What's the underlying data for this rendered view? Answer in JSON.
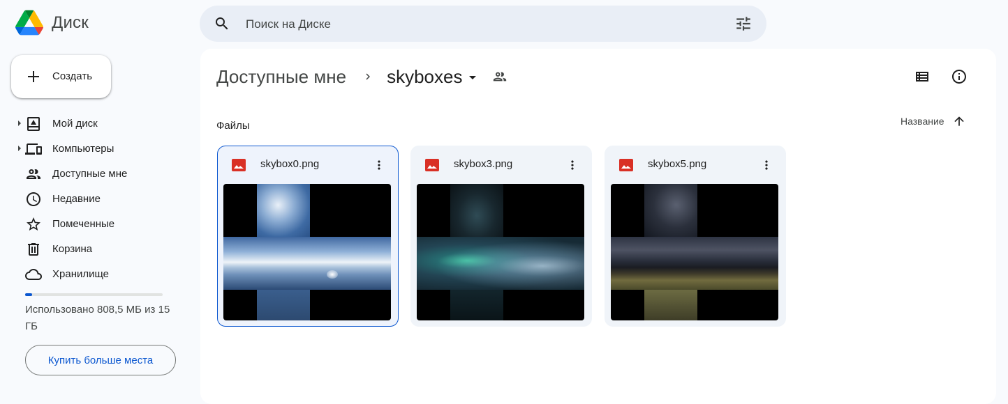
{
  "app": {
    "name": "Диск"
  },
  "search": {
    "placeholder": "Поиск на Диске"
  },
  "sidebar": {
    "new_label": "Создать",
    "items": [
      {
        "label": "Мой диск",
        "icon": "my-drive-icon",
        "expandable": true
      },
      {
        "label": "Компьютеры",
        "icon": "computers-icon",
        "expandable": true
      },
      {
        "label": "Доступные мне",
        "icon": "shared-with-me-icon",
        "expandable": false
      },
      {
        "label": "Недавние",
        "icon": "clock-icon",
        "expandable": false
      },
      {
        "label": "Помеченные",
        "icon": "star-icon",
        "expandable": false
      },
      {
        "label": "Корзина",
        "icon": "trash-icon",
        "expandable": false
      },
      {
        "label": "Хранилище",
        "icon": "cloud-icon",
        "expandable": false
      }
    ],
    "storage": {
      "used_text": "Использовано 808,5 МБ из 15 ГБ",
      "used_fraction": 0.053
    },
    "buy_label": "Купить больше места"
  },
  "main": {
    "breadcrumb": {
      "root": "Доступные мне",
      "current": "skyboxes"
    },
    "section_label": "Файлы",
    "sort_label": "Название",
    "files": [
      {
        "name": "skybox0.png",
        "type": "image",
        "selected": true
      },
      {
        "name": "skybox3.png",
        "type": "image",
        "selected": false
      },
      {
        "name": "skybox5.png",
        "type": "image",
        "selected": false
      }
    ]
  },
  "colors": {
    "accent": "#0b57d0",
    "image_file": "#d93025",
    "page_bg": "#f8fafd",
    "search_bg": "#e9eef6"
  }
}
